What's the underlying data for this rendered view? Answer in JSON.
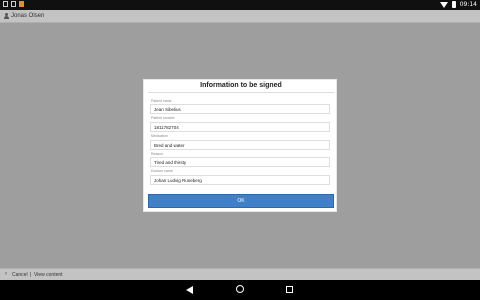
{
  "status_bar": {
    "time": "09:14",
    "icons": [
      "image-icon",
      "square-icon",
      "notification-app-icon",
      "wifi-icon",
      "battery-icon"
    ],
    "accent_color": "#e0912b"
  },
  "app_bar": {
    "user_name": "Jonas Olsen"
  },
  "dialog": {
    "title": "Information to be signed",
    "fields": [
      {
        "label": "Patient name",
        "value": "Jean Sibelius"
      },
      {
        "label": "Patient number",
        "value": "1811782704"
      },
      {
        "label": "Medication",
        "value": "Bred and water"
      },
      {
        "label": "Reason",
        "value": "Tired and thirsty"
      },
      {
        "label": "Doctors name",
        "value": "Johan Ludvig Runeberg"
      }
    ],
    "ok_label": "OK",
    "button_color": "#3f80c8"
  },
  "bottom_bar": {
    "cancel_label": "Cancel",
    "separator": "|",
    "view_label": "View content"
  }
}
